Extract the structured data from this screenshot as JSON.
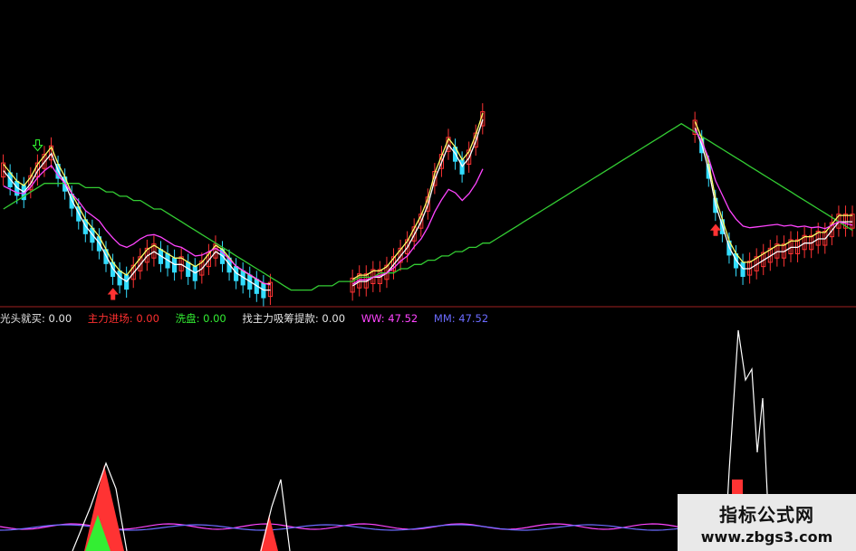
{
  "legend": [
    {
      "label": "光头就买:",
      "value": "0.00",
      "color": "#e6e6e6"
    },
    {
      "label": "主力进场:",
      "value": "0.00",
      "color": "#ff3030"
    },
    {
      "label": "洗盘:",
      "value": "0.00",
      "color": "#33ee33"
    },
    {
      "label": "找主力吸筹提款:",
      "value": "0.00",
      "color": "#e6e6e6"
    },
    {
      "label": "WW:",
      "value": "47.52",
      "color": "#ff44ff"
    },
    {
      "label": "MM:",
      "value": "47.52",
      "color": "#6b6bff"
    }
  ],
  "watermark": {
    "line1": "指标公式网",
    "line2": "www.zbgs3.com"
  },
  "colors": {
    "up": "#ff3333",
    "down": "#33ddff",
    "ma5": "#ffffff",
    "ma10": "#ffff66",
    "ma20": "#ff44ff",
    "ma60": "#33cc33",
    "divider": "#a02020"
  },
  "chart_data": [
    {
      "type": "candlestick",
      "panel": "price",
      "series": [
        {
          "name": "MA5",
          "color": "#ffffff",
          "values": [
            60,
            58,
            56,
            55,
            57,
            60,
            62,
            64,
            60,
            57,
            53,
            50,
            47,
            45,
            43,
            40,
            37,
            35,
            34,
            36,
            38,
            40,
            41,
            40,
            39,
            38,
            38,
            37,
            36,
            37,
            39,
            41,
            40,
            38,
            36,
            35,
            34,
            33,
            32,
            32,
            null,
            null,
            null,
            null,
            null,
            null,
            null,
            null,
            null,
            null,
            null,
            33,
            34,
            34,
            35,
            35,
            36,
            38,
            40,
            42,
            45,
            48,
            52,
            58,
            62,
            66,
            64,
            61,
            63,
            67,
            72,
            null,
            null,
            null,
            null,
            null,
            null,
            null,
            null,
            null,
            null,
            null,
            null,
            null,
            null,
            null,
            null,
            null,
            null,
            null,
            null,
            null,
            null,
            null,
            null,
            null,
            null,
            null,
            null,
            null,
            null,
            70,
            66,
            60,
            52,
            47,
            42,
            39,
            37,
            37,
            38,
            39,
            40,
            41,
            41,
            42,
            42,
            43,
            43,
            44,
            44,
            46,
            48,
            48,
            48
          ]
        },
        {
          "name": "MA60",
          "color": "#33cc33",
          "values": [
            51,
            52,
            53,
            54,
            55,
            56,
            57,
            57,
            57,
            57,
            57,
            57,
            56,
            56,
            56,
            55,
            55,
            54,
            54,
            53,
            53,
            52,
            51,
            51,
            50,
            49,
            48,
            47,
            46,
            45,
            44,
            43,
            42,
            41,
            40,
            39,
            38,
            37,
            36,
            35,
            34,
            33,
            32,
            32,
            32,
            32,
            33,
            33,
            33,
            34,
            34,
            34,
            35,
            35,
            35,
            36,
            36,
            36,
            37,
            37,
            38,
            38,
            39,
            39,
            40,
            40,
            41,
            41,
            42,
            42,
            43,
            43,
            44,
            45,
            46,
            47,
            48,
            49,
            50,
            51,
            52,
            53,
            54,
            55,
            56,
            57,
            58,
            59,
            60,
            61,
            62,
            63,
            64,
            65,
            66,
            67,
            68,
            69,
            70,
            71,
            70,
            69,
            68,
            67,
            66,
            65,
            64,
            63,
            62,
            61,
            60,
            59,
            58,
            57,
            56,
            55,
            54,
            53,
            52,
            51,
            50,
            49,
            48,
            47,
            46
          ]
        }
      ],
      "ylim": [
        30,
        100
      ]
    },
    {
      "type": "area",
      "panel": "indicator",
      "series": [
        {
          "name": "WW",
          "color": "#ff44ff",
          "values": [
            47.52
          ]
        },
        {
          "name": "MM",
          "color": "#6b6bff",
          "values": [
            47.52
          ]
        }
      ],
      "ylim": [
        0,
        100
      ]
    }
  ]
}
